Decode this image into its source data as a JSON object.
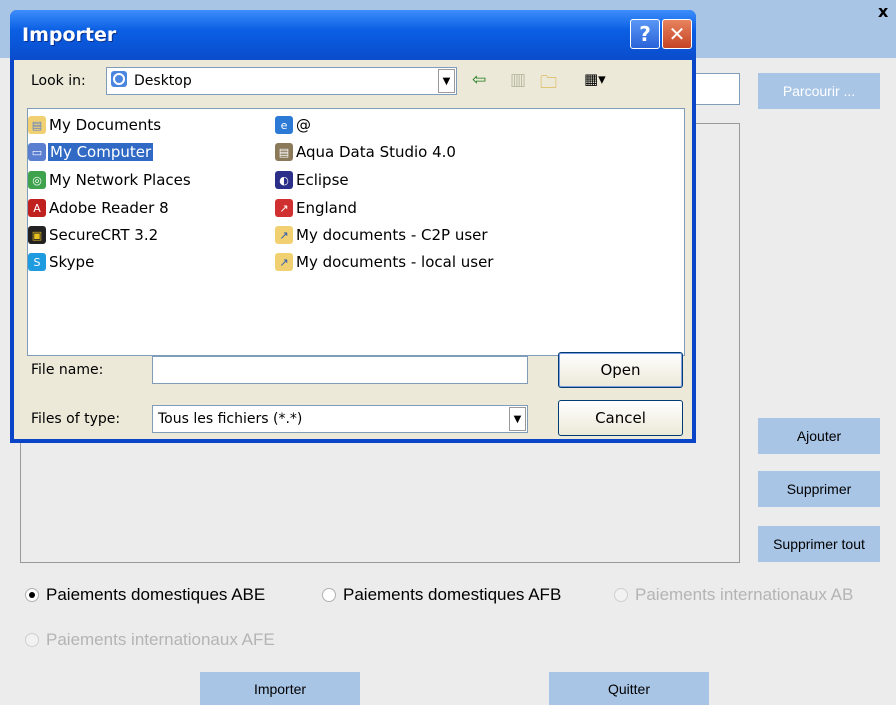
{
  "background": {
    "close_glyph": "x",
    "browse_button": "Parcourir ...",
    "add_button": "Ajouter",
    "delete_button": "Supprimer",
    "delete_all_button": "Supprimer tout",
    "radios": [
      {
        "label": "Paiements domestiques ABE",
        "checked": true,
        "disabled": false
      },
      {
        "label": "Paiements domestiques AFB",
        "checked": false,
        "disabled": false
      },
      {
        "label": "Paiements internationaux AB",
        "checked": false,
        "disabled": true
      },
      {
        "label": "Paiements internationaux AFE",
        "checked": false,
        "disabled": true
      }
    ],
    "import_button": "Importer",
    "quit_button": "Quitter"
  },
  "dialog": {
    "title": "Importer",
    "help_glyph": "?",
    "close_glyph": "✕",
    "look_in_label": "Look in:",
    "look_in_value": "Desktop",
    "files": [
      {
        "label": "My Documents",
        "icon": "folder-documents-icon",
        "selected": false
      },
      {
        "label": "My Computer",
        "icon": "computer-icon",
        "selected": true
      },
      {
        "label": "My Network Places",
        "icon": "network-icon",
        "selected": false
      },
      {
        "label": "Adobe Reader 8",
        "icon": "adobe-reader-shortcut-icon",
        "selected": false
      },
      {
        "label": "SecureCRT 3.2",
        "icon": "securecrt-shortcut-icon",
        "selected": false
      },
      {
        "label": "Skype",
        "icon": "skype-shortcut-icon",
        "selected": false
      },
      {
        "label": "@",
        "icon": "internet-shortcut-icon",
        "selected": false
      },
      {
        "label": "Aqua Data Studio 4.0",
        "icon": "app-shortcut-icon",
        "selected": false
      },
      {
        "label": "Eclipse",
        "icon": "eclipse-shortcut-icon",
        "selected": false
      },
      {
        "label": "England",
        "icon": "shortcut-icon",
        "selected": false
      },
      {
        "label": "My documents - C2P user",
        "icon": "folder-shortcut-icon",
        "selected": false
      },
      {
        "label": "My documents - local user",
        "icon": "folder-shortcut-icon",
        "selected": false
      }
    ],
    "file_name_label": "File name:",
    "file_name_value": "",
    "files_of_type_label": "Files of type:",
    "files_of_type_value": "Tous les fichiers (*.*)",
    "open_button": "Open",
    "cancel_button": "Cancel"
  },
  "colors": {
    "accent": "#a9c5e6",
    "selection": "#316ac5",
    "dialog_title": "#0a4ccc"
  }
}
